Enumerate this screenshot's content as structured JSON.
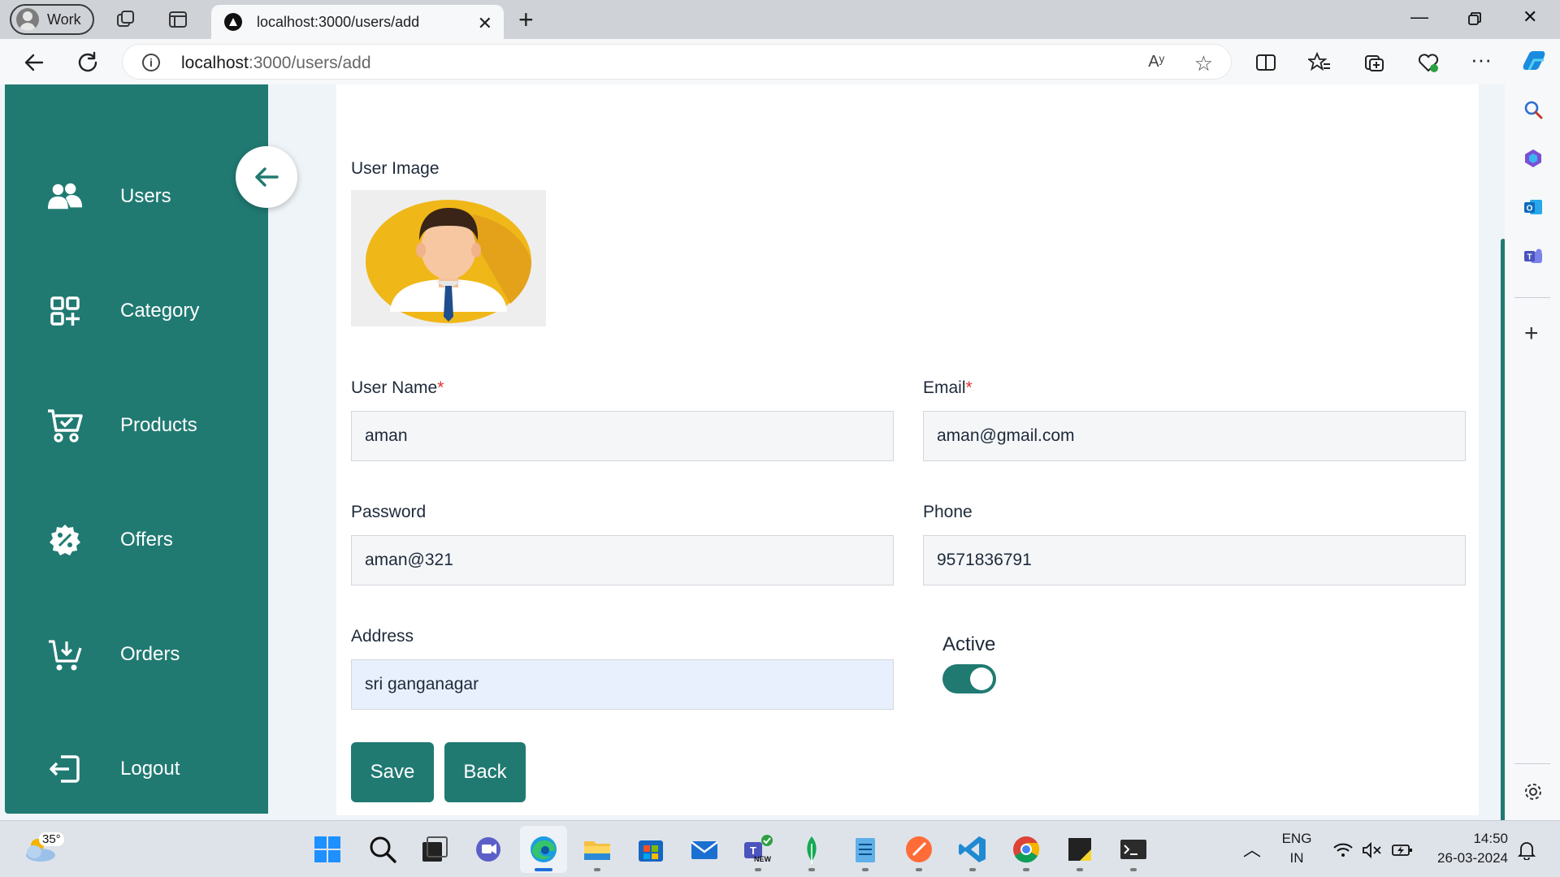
{
  "browser": {
    "profile_label": "Work",
    "tab_title": "localhost:3000/users/add",
    "url_host": "localhost",
    "url_path": ":3000/users/add"
  },
  "sidebar": {
    "items": [
      {
        "label": "Users",
        "icon": "users-icon"
      },
      {
        "label": "Category",
        "icon": "category-icon"
      },
      {
        "label": "Products",
        "icon": "cart-icon"
      },
      {
        "label": "Offers",
        "icon": "discount-badge-icon"
      },
      {
        "label": "Orders",
        "icon": "cart-add-icon"
      },
      {
        "label": "Logout",
        "icon": "logout-icon"
      }
    ],
    "bg_color": "#207a72"
  },
  "form": {
    "user_image_label": "User Image",
    "username_label": "User Name",
    "username_value": "aman",
    "email_label": "Email",
    "email_value": "aman@gmail.com",
    "password_label": "Password",
    "password_value": "aman@321",
    "phone_label": "Phone",
    "phone_value": "9571836791",
    "address_label": "Address",
    "address_value": "sri ganganagar",
    "active_label": "Active",
    "active_on": true,
    "required_mark": "*",
    "save_label": "Save",
    "back_label": "Back"
  },
  "taskbar": {
    "weather_temp": "35°",
    "lang_top": "ENG",
    "lang_bottom": "IN",
    "time": "14:50",
    "date": "26-03-2024",
    "teams_badge": "NEW"
  }
}
